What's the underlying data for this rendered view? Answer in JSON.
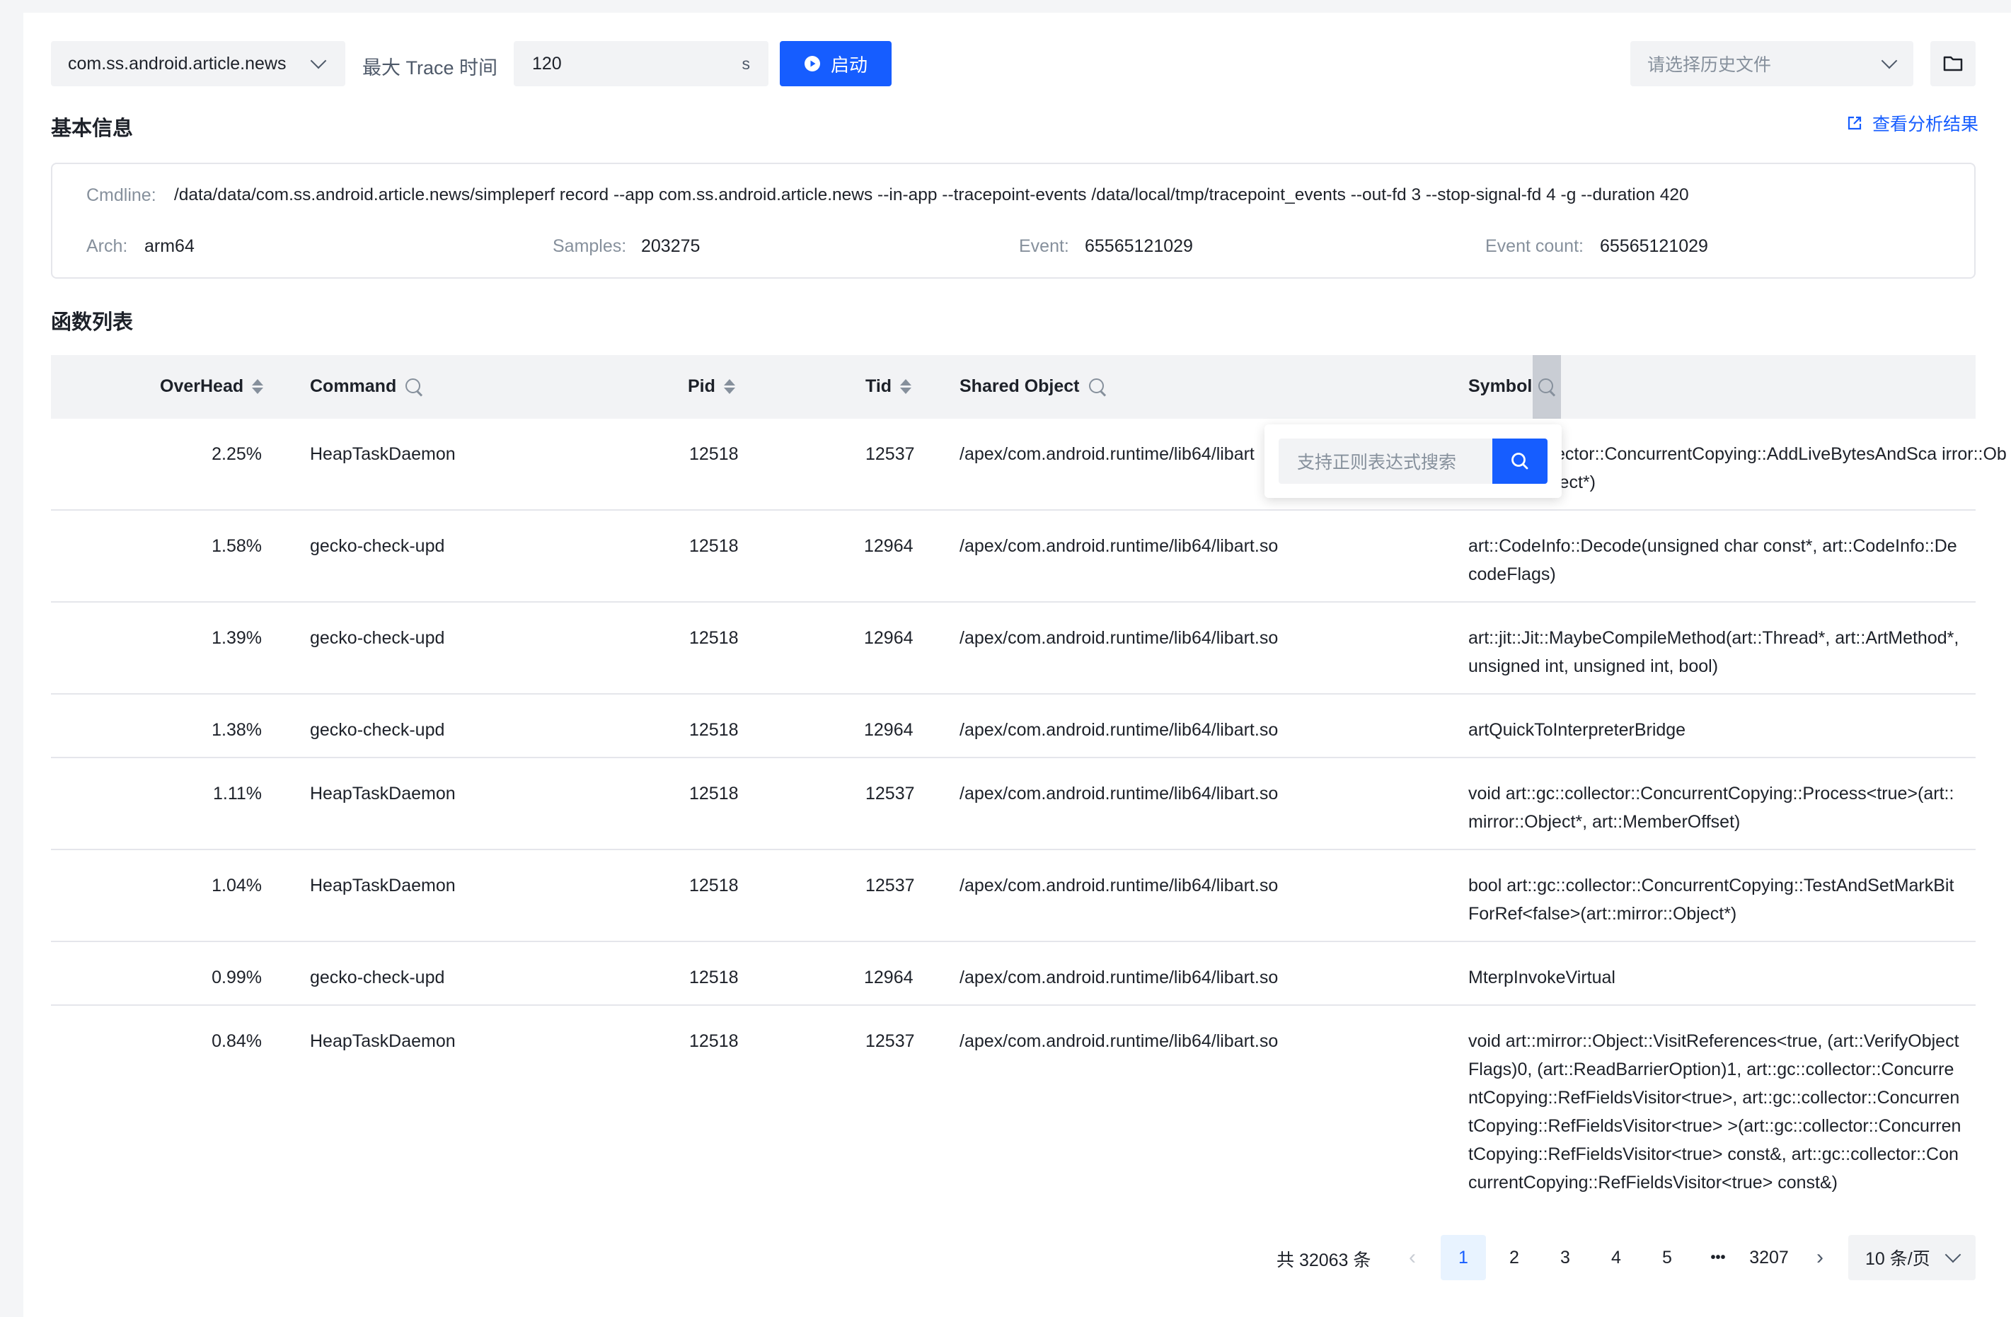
{
  "toolbar": {
    "app_select": "com.ss.android.article.news",
    "max_trace_label": "最大 Trace 时间",
    "trace_value": "120",
    "trace_unit": "s",
    "start_label": "启动",
    "history_placeholder": "请选择历史文件"
  },
  "basic_info": {
    "title": "基本信息",
    "view_results_link": "查看分析结果",
    "cmdline_label": "Cmdline:",
    "cmdline_value": "/data/data/com.ss.android.article.news/simpleperf record --app com.ss.android.article.news --in-app --tracepoint-events /data/local/tmp/tracepoint_events --out-fd 3 --stop-signal-fd 4 -g --duration 420",
    "arch_label": "Arch:",
    "arch_value": "arm64",
    "samples_label": "Samples:",
    "samples_value": "203275",
    "event_label": "Event:",
    "event_value": "65565121029",
    "event_count_label": "Event count:",
    "event_count_value": "65565121029"
  },
  "function_list": {
    "title": "函数列表",
    "columns": {
      "overhead": "OverHead",
      "command": "Command",
      "pid": "Pid",
      "tid": "Tid",
      "shared_object": "Shared Object",
      "symbol": "Symbol"
    },
    "rows": [
      {
        "overhead": "2.25%",
        "command": "HeapTaskDaemon",
        "pid": "12518",
        "tid": "12537",
        "so": "/apex/com.android.runtime/lib64/libart",
        "symbol": "ector::ConcurrentCopying::AddLiveBytesAndSca irror::Object*)"
      },
      {
        "overhead": "1.58%",
        "command": "gecko-check-upd",
        "pid": "12518",
        "tid": "12964",
        "so": "/apex/com.android.runtime/lib64/libart.so",
        "symbol": "art::CodeInfo::Decode(unsigned char const*, art::CodeInfo::DecodeFlags)"
      },
      {
        "overhead": "1.39%",
        "command": "gecko-check-upd",
        "pid": "12518",
        "tid": "12964",
        "so": "/apex/com.android.runtime/lib64/libart.so",
        "symbol": "art::jit::Jit::MaybeCompileMethod(art::Thread*, art::ArtMethod*, unsigned int, unsigned int, bool)"
      },
      {
        "overhead": "1.38%",
        "command": "gecko-check-upd",
        "pid": "12518",
        "tid": "12964",
        "so": "/apex/com.android.runtime/lib64/libart.so",
        "symbol": "artQuickToInterpreterBridge"
      },
      {
        "overhead": "1.11%",
        "command": "HeapTaskDaemon",
        "pid": "12518",
        "tid": "12537",
        "so": "/apex/com.android.runtime/lib64/libart.so",
        "symbol": "void art::gc::collector::ConcurrentCopying::Process<true>(art::mirror::Object*, art::MemberOffset)"
      },
      {
        "overhead": "1.04%",
        "command": "HeapTaskDaemon",
        "pid": "12518",
        "tid": "12537",
        "so": "/apex/com.android.runtime/lib64/libart.so",
        "symbol": "bool art::gc::collector::ConcurrentCopying::TestAndSetMarkBitForRef<false>(art::mirror::Object*)"
      },
      {
        "overhead": "0.99%",
        "command": "gecko-check-upd",
        "pid": "12518",
        "tid": "12964",
        "so": "/apex/com.android.runtime/lib64/libart.so",
        "symbol": "MterpInvokeVirtual"
      },
      {
        "overhead": "0.84%",
        "command": "HeapTaskDaemon",
        "pid": "12518",
        "tid": "12537",
        "so": "/apex/com.android.runtime/lib64/libart.so",
        "symbol": "void art::mirror::Object::VisitReferences<true, (art::VerifyObjectFlags)0, (art::ReadBarrierOption)1, art::gc::collector::ConcurrentCopying::RefFieldsVisitor<true>, art::gc::collector::ConcurrentCopying::RefFieldsVisitor<true> >(art::gc::collector::ConcurrentCopying::RefFieldsVisitor<true> const&, art::gc::collector::ConcurrentCopying::RefFieldsVisitor<true> const&)"
      }
    ],
    "symbol_search_placeholder": "支持正则表达式搜索"
  },
  "pagination": {
    "total_text": "共 32063 条",
    "pages": [
      "1",
      "2",
      "3",
      "4",
      "5"
    ],
    "ellipsis": "•••",
    "last_page": "3207",
    "page_size": "10 条/页"
  }
}
